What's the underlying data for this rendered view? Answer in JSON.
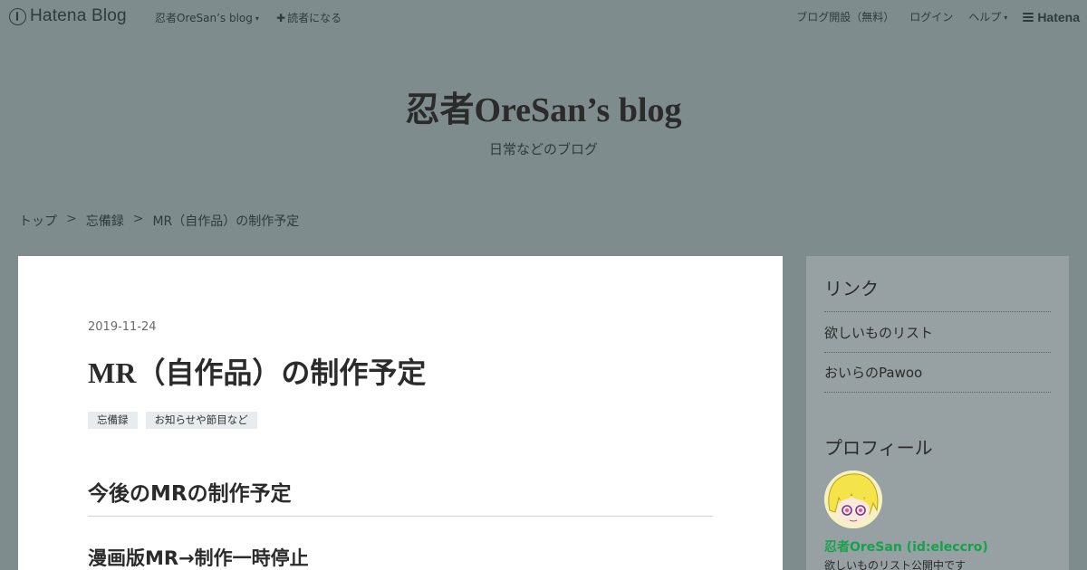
{
  "topbar": {
    "logo_text": "Hatena Blog",
    "blog_menu": "忍者OreSan’s blog",
    "reader_button": "読者になる",
    "links": [
      "ブログ開設（無料）",
      "ログイン",
      "ヘルプ"
    ],
    "hatena_brand": "Hatena"
  },
  "header": {
    "title": "忍者OreSan’s blog",
    "description": "日常などのブログ"
  },
  "breadcrumb": {
    "items": [
      "トップ",
      "忘備録",
      "MR（自作品）の制作予定"
    ],
    "separator": ">"
  },
  "entry": {
    "date": "2019-11-24",
    "title": "MR（自作品）の制作予定",
    "categories": [
      "忘備録",
      "お知らせや節目など"
    ],
    "heading2": "今後のMRの制作予定",
    "heading3": "漫画版MR→制作一時停止"
  },
  "sidebar": {
    "links_title": "リンク",
    "links": [
      "欲しいものリスト",
      "おいらのPawoo"
    ],
    "profile_title": "プロフィール",
    "profile_name": "忍者OreSan (id:eleccro)",
    "profile_desc": "欲しいものリスト公開中です"
  },
  "colors": {
    "background": "#7f8c8d",
    "content": "#ffffff",
    "sidebar": "#97a0a3",
    "profile_link": "#15a34a"
  }
}
